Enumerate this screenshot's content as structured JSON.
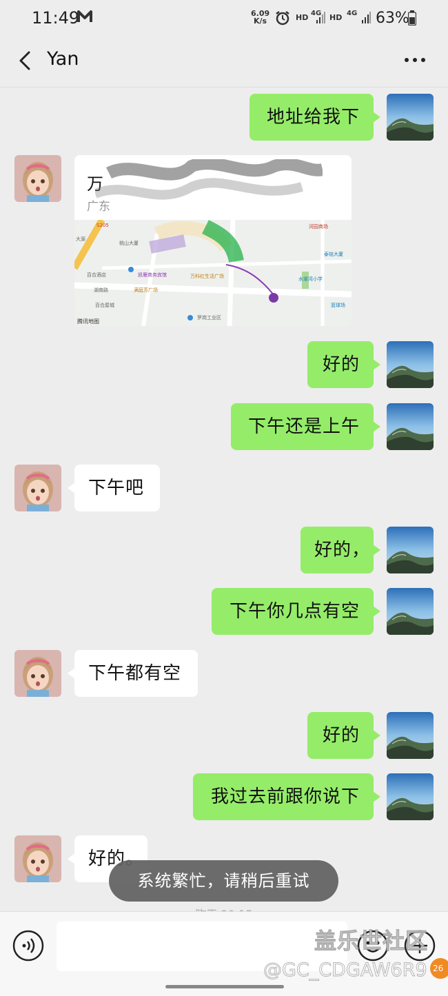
{
  "status_bar": {
    "time": "11:49",
    "net_speed_value": "6.09",
    "net_speed_unit": "K/s",
    "net1": "HD",
    "net1_gen": "4G",
    "net2": "HD",
    "net2_gen": "4G",
    "battery": "63%"
  },
  "header": {
    "title": "Yan"
  },
  "location": {
    "name": "万",
    "address": "广东",
    "map_labels": [
      "S205",
      "大源",
      "桃山大厦",
      "百合酒店",
      "凯雁商务宾馆",
      "万科红生活广场",
      "满庭芳广场",
      "湖南路",
      "百合屋城",
      "罗岗工业区",
      "水棠湾小学",
      "篮球场",
      "泰铭大厦",
      "河园商场",
      "腾讯地图"
    ]
  },
  "messages": [
    {
      "from": "me",
      "text": "地址给我下"
    },
    {
      "from": "them",
      "type": "location"
    },
    {
      "from": "me",
      "text": "好的"
    },
    {
      "from": "me",
      "text": "下午还是上午"
    },
    {
      "from": "them",
      "text": "下午吧"
    },
    {
      "from": "me",
      "text": "好的，"
    },
    {
      "from": "me",
      "text": "下午你几点有空"
    },
    {
      "from": "them",
      "text": "下午都有空"
    },
    {
      "from": "me",
      "text": "好的"
    },
    {
      "from": "me",
      "text": "我过去前跟你说下"
    },
    {
      "from": "them",
      "text": "好的。"
    }
  ],
  "toast": "系统繁忙，请稍后重试",
  "timestamp": "昨天 20:15",
  "watermark": {
    "line1": "盖乐世社区",
    "line2": "@GC_CDGAW6R9",
    "badge": "26"
  },
  "colors": {
    "background": "#ededed",
    "my_bubble": "#95ec69",
    "their_bubble": "#ffffff"
  }
}
